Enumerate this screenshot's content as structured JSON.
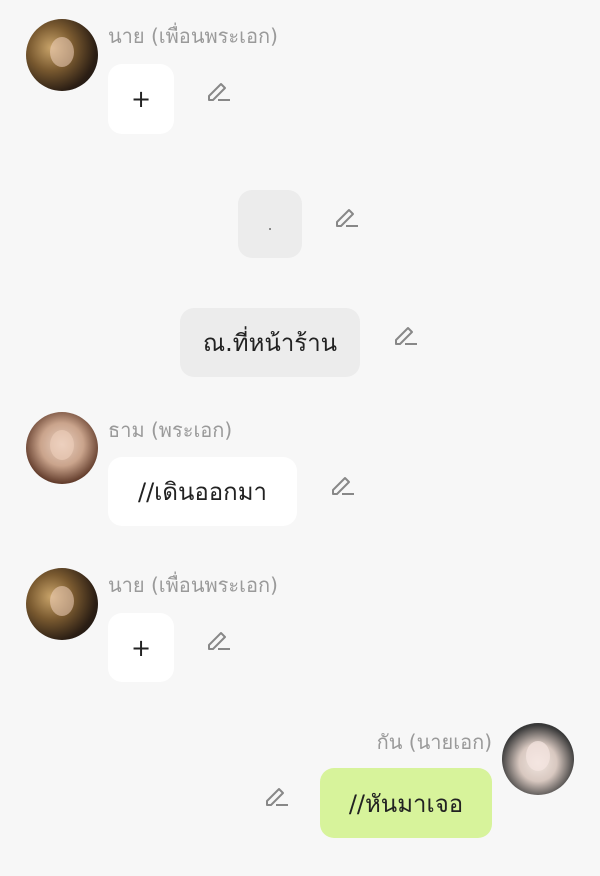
{
  "messages": [
    {
      "sender": "นาย (เพื่อนพระเอก)",
      "text": "+"
    },
    {
      "text": "."
    },
    {
      "text": "ณ.ที่หน้าร้าน"
    },
    {
      "sender": "ธาม (พระเอก)",
      "text": "//เดินออกมา"
    },
    {
      "sender": "นาย (เพื่อนพระเอก)",
      "text": "+"
    },
    {
      "sender": "กัน (นายเอก)",
      "text": "//หันมาเจอ"
    }
  ],
  "icons": {
    "edit": "pencil-edit-icon"
  },
  "colors": {
    "background": "#f7f7f7",
    "bubble_white": "#ffffff",
    "bubble_grey": "#ececec",
    "bubble_green": "#d7f39b",
    "name_text": "#9a9a9a"
  }
}
